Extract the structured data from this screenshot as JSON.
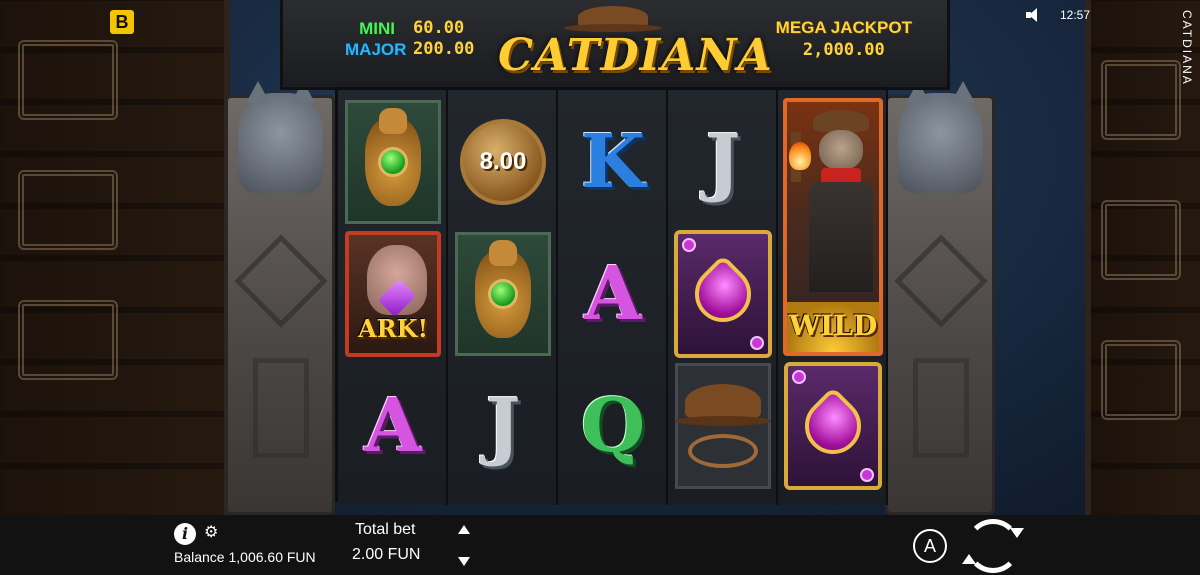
{
  "brand": {
    "logo_letter": "B"
  },
  "status": {
    "time": "12:57",
    "sound_icon": "speaker-icon"
  },
  "game_title_vertical": "CATDIANA",
  "jackpots": {
    "mini": {
      "label": "MINI",
      "value": "60.00"
    },
    "major": {
      "label": "MAJOR",
      "value": "200.00"
    },
    "mega": {
      "label": "MEGA JACKPOT",
      "value": "2,000.00"
    }
  },
  "logo": {
    "text": "CATDIANA"
  },
  "reels": [
    {
      "symbols": [
        "cat-amulet",
        "ark-cat",
        "A"
      ],
      "labels": [
        "",
        "ARK!",
        "A"
      ]
    },
    {
      "symbols": [
        "coin",
        "cat-amulet",
        "J"
      ],
      "labels": [
        "8.00",
        "",
        "J"
      ]
    },
    {
      "symbols": [
        "K",
        "A",
        "Q"
      ],
      "labels": [
        "K",
        "A",
        "Q"
      ]
    },
    {
      "symbols": [
        "J",
        "heart-gem",
        "hat-whip"
      ],
      "labels": [
        "J",
        "",
        ""
      ]
    },
    {
      "symbols": [
        "wild-tall",
        "heart-gem"
      ],
      "labels": [
        "WILD",
        ""
      ]
    }
  ],
  "bottom_bar": {
    "balance": "Balance 1,006.60 FUN",
    "total_bet_label": "Total bet",
    "total_bet_value": "2.00 FUN",
    "info_icon": "info-icon",
    "settings_icon": "gear-icon",
    "autoplay_label": "A"
  }
}
